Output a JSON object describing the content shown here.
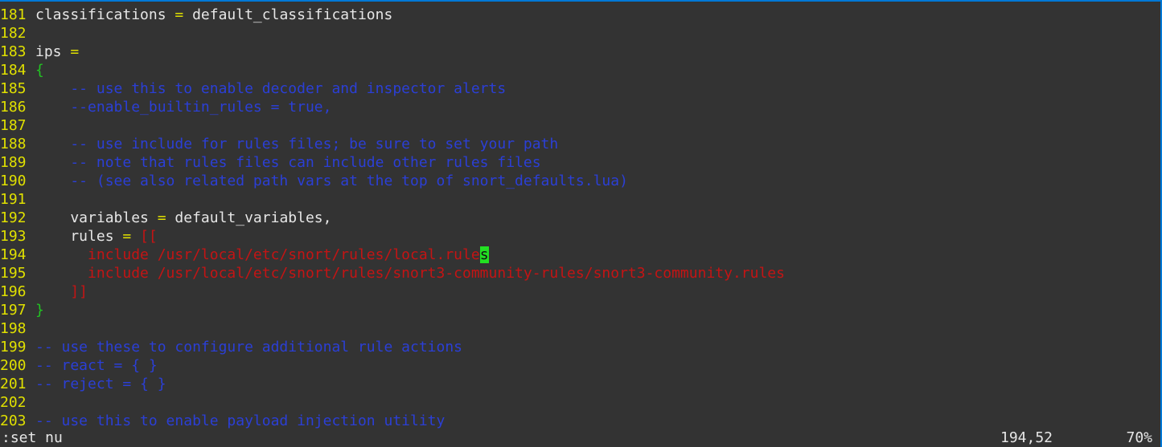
{
  "editor": {
    "lines": [
      {
        "num": "181",
        "segments": [
          {
            "t": "classifications ",
            "c": "text"
          },
          {
            "t": "=",
            "c": "op"
          },
          {
            "t": " default_classifications",
            "c": "text"
          }
        ]
      },
      {
        "num": "182",
        "segments": []
      },
      {
        "num": "183",
        "segments": [
          {
            "t": "ips ",
            "c": "text"
          },
          {
            "t": "=",
            "c": "op"
          }
        ]
      },
      {
        "num": "184",
        "segments": [
          {
            "t": "{",
            "c": "brace"
          }
        ]
      },
      {
        "num": "185",
        "segments": [
          {
            "t": "    -- use this to enable decoder and inspector alerts",
            "c": "comment"
          }
        ]
      },
      {
        "num": "186",
        "segments": [
          {
            "t": "    --enable_builtin_rules = true,",
            "c": "comment"
          }
        ]
      },
      {
        "num": "187",
        "segments": []
      },
      {
        "num": "188",
        "segments": [
          {
            "t": "    -- use include for rules files; be sure to set your path",
            "c": "comment"
          }
        ]
      },
      {
        "num": "189",
        "segments": [
          {
            "t": "    -- note that rules files can include other rules files",
            "c": "comment"
          }
        ]
      },
      {
        "num": "190",
        "segments": [
          {
            "t": "    -- (see also related path vars at the top of snort_defaults.lua)",
            "c": "comment"
          }
        ]
      },
      {
        "num": "191",
        "segments": []
      },
      {
        "num": "192",
        "segments": [
          {
            "t": "    variables ",
            "c": "text"
          },
          {
            "t": "=",
            "c": "op"
          },
          {
            "t": " default_variables,",
            "c": "text"
          }
        ]
      },
      {
        "num": "193",
        "segments": [
          {
            "t": "    rules ",
            "c": "text"
          },
          {
            "t": "=",
            "c": "op"
          },
          {
            "t": " ",
            "c": "text"
          },
          {
            "t": "[[",
            "c": "string"
          }
        ]
      },
      {
        "num": "194",
        "segments": [
          {
            "t": "      include /usr/local/etc/snort/rules/local.rule",
            "c": "string"
          },
          {
            "t": "s",
            "c": "cursor"
          }
        ]
      },
      {
        "num": "195",
        "segments": [
          {
            "t": "      include /usr/local/etc/snort/rules/snort3-community-rules/snort3-community.rules",
            "c": "string"
          }
        ]
      },
      {
        "num": "196",
        "segments": [
          {
            "t": "    ]]",
            "c": "string"
          }
        ]
      },
      {
        "num": "197",
        "segments": [
          {
            "t": "}",
            "c": "brace"
          }
        ]
      },
      {
        "num": "198",
        "segments": []
      },
      {
        "num": "199",
        "segments": [
          {
            "t": "-- use these to configure additional rule actions",
            "c": "comment"
          }
        ]
      },
      {
        "num": "200",
        "segments": [
          {
            "t": "-- react = { }",
            "c": "comment"
          }
        ]
      },
      {
        "num": "201",
        "segments": [
          {
            "t": "-- reject = { }",
            "c": "comment"
          }
        ]
      },
      {
        "num": "202",
        "segments": []
      },
      {
        "num": "203",
        "segments": [
          {
            "t": "-- use this to enable payload injection utility",
            "c": "comment"
          }
        ]
      }
    ]
  },
  "status": {
    "command": ":set nu",
    "position": "194,52",
    "percent": "70%"
  },
  "colors": {
    "background": "#333333",
    "line_number": "#e0e000",
    "comment": "#2b3fd6",
    "string": "#c41414",
    "brace": "#22c522",
    "cursor": "#22e022",
    "window_border": "#0078d7"
  }
}
